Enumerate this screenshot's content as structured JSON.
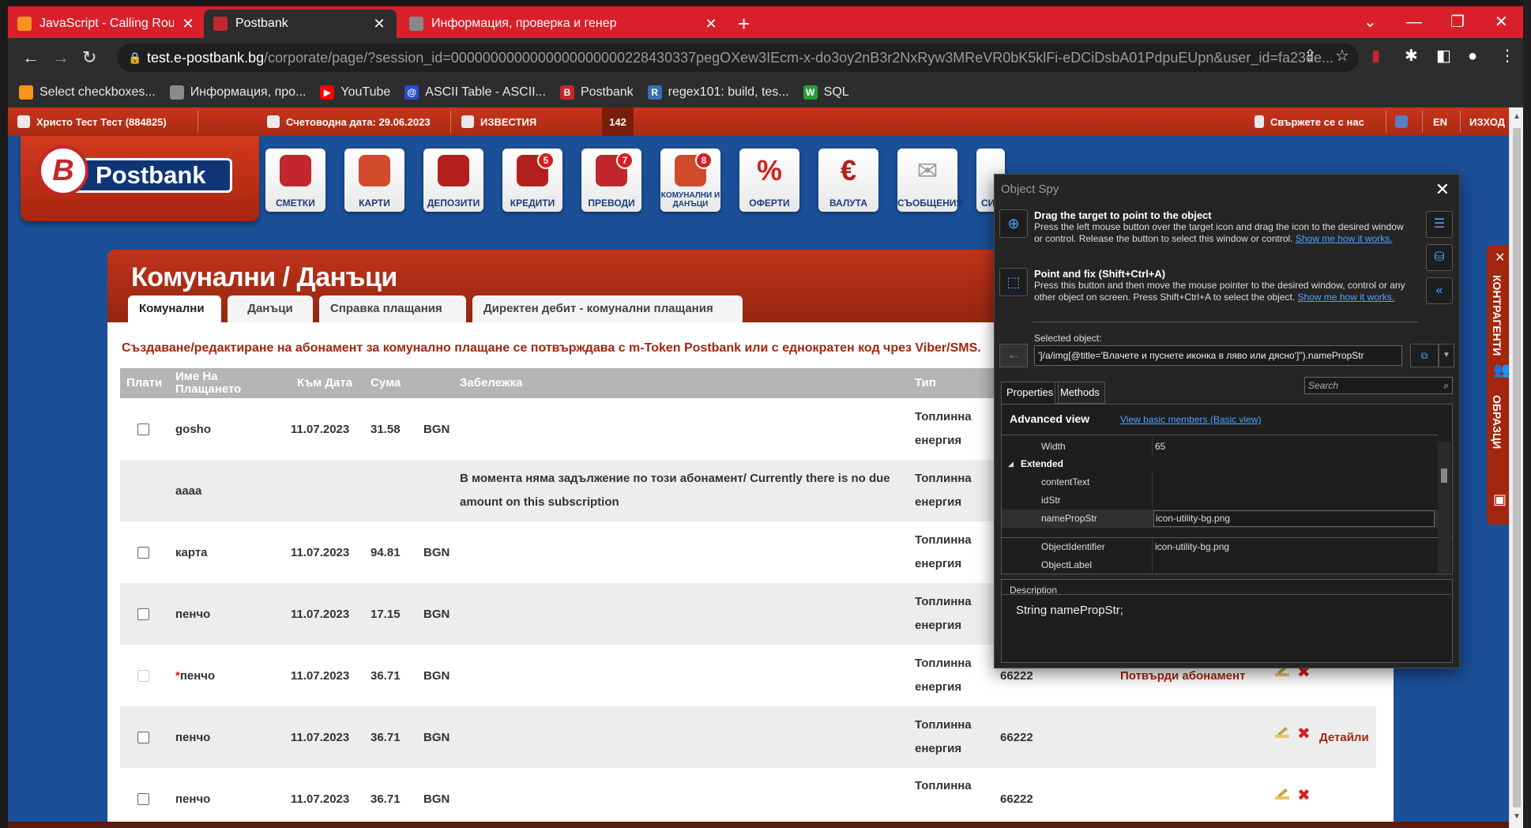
{
  "browser": {
    "tabs": [
      {
        "title": "JavaScript - Calling Routines and",
        "favicon_color": "#f7931e"
      },
      {
        "title": "Postbank",
        "favicon_color": "#c1272d"
      },
      {
        "title": "Информация, проверка и генер",
        "favicon_color": "#888888"
      }
    ],
    "url_domain": "test.e-postbank.bg",
    "url_path": "/corporate/page/?session_id=0000000000000000000000228430337pegOXew3IEcm-x-do3oy2nB3r2NxRyw3MReVR0bK5klFi-eDCiDsbA01PdpuEUpn&user_id=fa23de...",
    "bookmarks": [
      {
        "label": "Select checkboxes...",
        "icon": "#f7931e"
      },
      {
        "label": "Информация, про...",
        "icon": "#8a8a8a"
      },
      {
        "label": "YouTube",
        "icon": "#ff0000"
      },
      {
        "label": "ASCII Table - ASCII...",
        "icon": "#2a4cd0"
      },
      {
        "label": "Postbank",
        "icon": "#c1272d"
      },
      {
        "label": "regex101: build, tes...",
        "icon": "#3a6fb8"
      },
      {
        "label": "SQL",
        "icon": "#2a9d3a"
      }
    ]
  },
  "topbar": {
    "user": "Христо Тест Тест (884825)",
    "date": "Счетоводна дата: 29.06.2023",
    "news": "ИЗВЕСТИЯ",
    "count": "142",
    "contact": "Свържете се с нас",
    "lang": "EN",
    "logout": "ИЗХОД"
  },
  "logo": {
    "letter": "B",
    "text": "Postbank"
  },
  "nav": [
    {
      "label": "СМЕТКИ",
      "color": "#c1272d",
      "badge": ""
    },
    {
      "label": "КАРТИ",
      "color": "#d24a2a",
      "badge": ""
    },
    {
      "label": "ДЕПОЗИТИ",
      "color": "#b3201b",
      "badge": ""
    },
    {
      "label": "КРЕДИТИ",
      "color": "#b3201b",
      "badge": "5"
    },
    {
      "label": "ПРЕВОДИ",
      "color": "#c1272d",
      "badge": "7"
    },
    {
      "label": "КОМУНАЛНИ И ДАНЪЦИ",
      "color": "#d24a2a",
      "badge": "8"
    },
    {
      "label": "ОФЕРТИ",
      "color": "#d4201f",
      "badge": ""
    },
    {
      "label": "ВАЛУТА",
      "color": "#b3201b",
      "badge": ""
    },
    {
      "label": "СЪОБЩЕНИЯ",
      "color": "#9a9a9a",
      "badge": ""
    },
    {
      "label": "СИГ",
      "color": "#c1272d",
      "badge": ""
    }
  ],
  "page": {
    "title": "Комунални / Данъци",
    "tabs": [
      "Комунални",
      "Данъци",
      "Справка плащания",
      "Директен дебит - комунални плащания"
    ],
    "notice": "Създаване/редактиране на абонамент за комунално плащане се потвърждава с m-Token Postbank или с еднократен код чрез Viber/SMS.",
    "columns": [
      "Плати",
      "Име На Плащането",
      "Към Дата",
      "Сума",
      "Забележка",
      "Тип"
    ],
    "rows": [
      {
        "check": "enabled",
        "name": "gosho",
        "date": "11.07.2023",
        "amount": "31.58",
        "currency": "BGN",
        "note": "",
        "type1": "Топлинна",
        "type2": "енергия",
        "code": "",
        "action": "",
        "link": ""
      },
      {
        "check": "none",
        "name": "аааа",
        "date": "",
        "amount": "",
        "currency": "",
        "note": "В момента няма задължение по този абонамент/ Currently there is no due amount on this subscription",
        "type1": "Топлинна",
        "type2": "енергия",
        "code": "",
        "action": "",
        "link": ""
      },
      {
        "check": "enabled",
        "name": "карта",
        "date": "11.07.2023",
        "amount": "94.81",
        "currency": "BGN",
        "note": "",
        "type1": "Топлинна",
        "type2": "енергия",
        "code": "",
        "action": "",
        "link": ""
      },
      {
        "check": "enabled",
        "name": "пенчо",
        "date": "11.07.2023",
        "amount": "17.15",
        "currency": "BGN",
        "note": "",
        "type1": "Топлинна",
        "type2": "енергия",
        "code": "",
        "action": "",
        "link": ""
      },
      {
        "check": "disabled",
        "name": "пенчо",
        "star": "*",
        "date": "11.07.2023",
        "amount": "36.71",
        "currency": "BGN",
        "note": "",
        "type1": "Топлинна",
        "type2": "енергия",
        "code": "66222",
        "action": "Потвърди абонамент",
        "link": ""
      },
      {
        "check": "enabled",
        "name": "пенчо",
        "date": "11.07.2023",
        "amount": "36.71",
        "currency": "BGN",
        "note": "",
        "type1": "Топлинна",
        "type2": "енергия",
        "code": "66222",
        "action": "",
        "link": "Детайли"
      },
      {
        "check": "enabled",
        "name": "пенчо",
        "date": "11.07.2023",
        "amount": "36.71",
        "currency": "BGN",
        "note": "",
        "type1": "Топлинна",
        "type2": "",
        "code": "66222",
        "action": "",
        "link": ""
      }
    ]
  },
  "side": {
    "tab1": "КОНТРАГЕНТИ",
    "tab2": "ОБРАЗЦИ"
  },
  "spy": {
    "title": "Object Spy",
    "drag_head": "Drag the target to point to the object",
    "drag_body": "Press the left mouse button over the target icon and drag the icon to the desired window or control. Release the button to select this window or control.",
    "drag_link": "Show me how it works.",
    "point_head": "Point and fix (Shift+Ctrl+A)",
    "point_body": "Press this button and then move the mouse pointer to the desired window, control or any other object on screen. Press Shift+Ctrl+A to select the object.",
    "point_link": "Show me how it works.",
    "selected_label": "Selected object:",
    "selected_value": "']/a/img[@title='Влачете и пуснете иконка в ляво или дясно']\").namePropStr",
    "tab_properties": "Properties",
    "tab_methods": "Methods",
    "search_placeholder": "Search",
    "advanced": "Advanced view",
    "basic_link": "View basic members (Basic view)",
    "width_key": "Width",
    "width_val": "65",
    "extended": "Extended",
    "props": [
      {
        "k": "contentText",
        "v": ""
      },
      {
        "k": "idStr",
        "v": ""
      },
      {
        "k": "namePropStr",
        "v": "icon-utility-bg.png"
      },
      {
        "k": "ObjectIdentifier",
        "v": "icon-utility-bg.png"
      },
      {
        "k": "ObjectLabel",
        "v": ""
      }
    ],
    "description_label": "Description",
    "description": "String namePropStr;"
  }
}
